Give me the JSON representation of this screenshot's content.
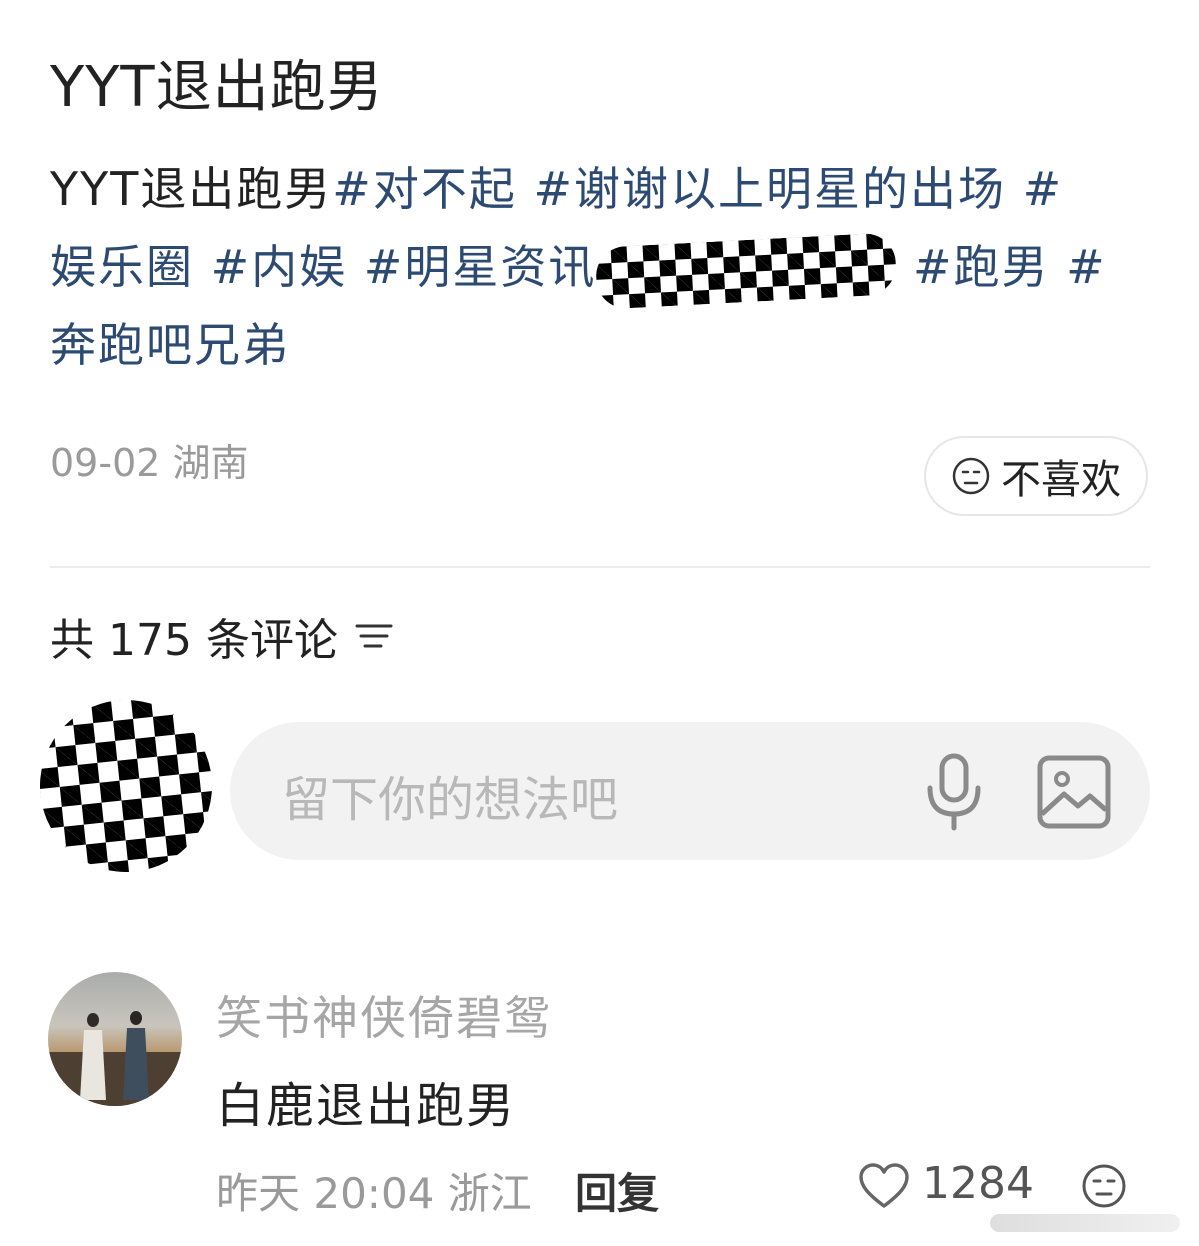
{
  "post": {
    "title": "YYT退出跑男",
    "body_text": "YYT退出跑男",
    "tags_line1": "#对不起 #谢谢以上明星的出场 #",
    "tags_line2": "娱乐圈 #内娱 #明星资讯",
    "tags_line2_end": "#跑男 #",
    "tags_line3": "奔跑吧兄弟",
    "date": "09-02",
    "location": "湖南",
    "dislike_label": "不喜欢"
  },
  "comments": {
    "count_label": "共 175 条评论",
    "input_placeholder": "留下你的想法吧",
    "items": [
      {
        "author": "笑书神侠倚碧鸳",
        "text": "白鹿退出跑男",
        "time": "昨天 20:04",
        "location": "浙江",
        "reply_label": "回复",
        "likes": "1284"
      }
    ]
  },
  "icons": {
    "dislike": "neutral-face-icon",
    "sort": "sort-lines-icon",
    "mic": "microphone-icon",
    "image": "image-icon",
    "like": "heart-icon"
  },
  "colors": {
    "tag": "#2c4a72",
    "meta": "#9a9a9a",
    "input_bg": "#f2f2f2"
  }
}
